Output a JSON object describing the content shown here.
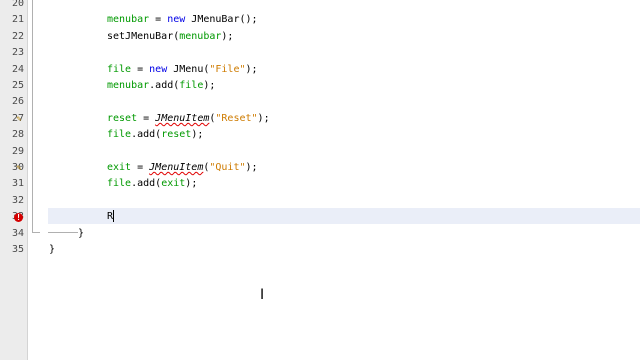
{
  "editor": {
    "lines": [
      {
        "n": "20",
        "segments": []
      },
      {
        "n": "21",
        "segments": [
          {
            "t": "menubar",
            "c": "fld"
          },
          {
            "t": " = ",
            "c": ""
          },
          {
            "t": "new",
            "c": "kw"
          },
          {
            "t": " JMenuBar();",
            "c": ""
          }
        ]
      },
      {
        "n": "22",
        "segments": [
          {
            "t": "setJMenuBar(",
            "c": ""
          },
          {
            "t": "menubar",
            "c": "fld"
          },
          {
            "t": ");",
            "c": ""
          }
        ]
      },
      {
        "n": "23",
        "segments": []
      },
      {
        "n": "24",
        "segments": [
          {
            "t": "file",
            "c": "fld"
          },
          {
            "t": " = ",
            "c": ""
          },
          {
            "t": "new",
            "c": "kw"
          },
          {
            "t": " JMenu(",
            "c": ""
          },
          {
            "t": "\"File\"",
            "c": "str"
          },
          {
            "t": ");",
            "c": ""
          }
        ]
      },
      {
        "n": "25",
        "segments": [
          {
            "t": "menubar",
            "c": "fld"
          },
          {
            "t": ".add(",
            "c": ""
          },
          {
            "t": "file",
            "c": "fld"
          },
          {
            "t": ");",
            "c": ""
          }
        ]
      },
      {
        "n": "26",
        "segments": []
      },
      {
        "n": "27",
        "segments": [
          {
            "t": "reset",
            "c": "fld"
          },
          {
            "t": " = ",
            "c": ""
          },
          {
            "t": "JMenuItem",
            "c": "italic squig"
          },
          {
            "t": "(",
            "c": ""
          },
          {
            "t": "\"Reset\"",
            "c": "str"
          },
          {
            "t": ");",
            "c": ""
          }
        ]
      },
      {
        "n": "28",
        "segments": [
          {
            "t": "file",
            "c": "fld"
          },
          {
            "t": ".add(",
            "c": ""
          },
          {
            "t": "reset",
            "c": "fld"
          },
          {
            "t": ");",
            "c": ""
          }
        ]
      },
      {
        "n": "29",
        "segments": []
      },
      {
        "n": "30",
        "segments": [
          {
            "t": "exit",
            "c": "fld"
          },
          {
            "t": " = ",
            "c": ""
          },
          {
            "t": "JMenuItem",
            "c": "italic squig"
          },
          {
            "t": "(",
            "c": ""
          },
          {
            "t": "\"Quit\"",
            "c": "str"
          },
          {
            "t": ");",
            "c": ""
          }
        ]
      },
      {
        "n": "31",
        "segments": [
          {
            "t": "file",
            "c": "fld"
          },
          {
            "t": ".add(",
            "c": ""
          },
          {
            "t": "exit",
            "c": "fld"
          },
          {
            "t": ");",
            "c": ""
          }
        ]
      },
      {
        "n": "32",
        "segments": []
      },
      {
        "n": "33",
        "segments": [
          {
            "t": "R",
            "c": ""
          }
        ]
      },
      {
        "n": "34",
        "segments": []
      },
      {
        "n": "35",
        "segments": []
      }
    ],
    "braces": {
      "line34": "}",
      "line35": "}"
    },
    "markers": {
      "warning_lines": [
        "27",
        "30"
      ],
      "error_line": "33",
      "error_glyph": "!"
    },
    "colors": {
      "keyword": "#0000e6",
      "string": "#ce7b00",
      "field": "#009900",
      "current_line": "#eaeef8",
      "error": "#d40000",
      "warning": "#b8860b"
    }
  },
  "cursor": {
    "icon": "text-ibeam-cursor",
    "glyph": "I"
  }
}
